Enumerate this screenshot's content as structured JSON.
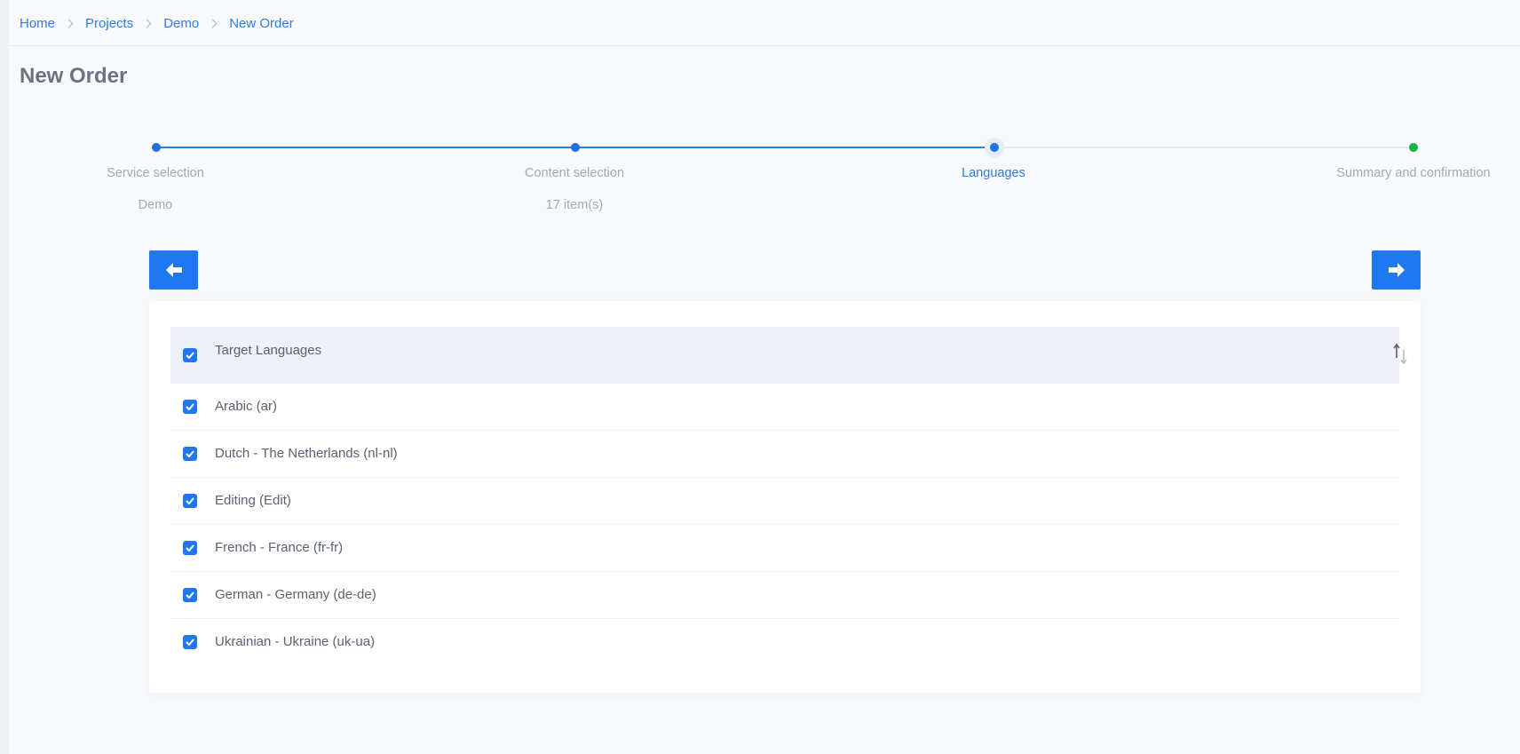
{
  "breadcrumb": [
    "Home",
    "Projects",
    "Demo",
    "New Order"
  ],
  "page": {
    "title": "New Order"
  },
  "stepper": {
    "steps": [
      {
        "label": "Service selection",
        "sub": "Demo",
        "state": "done"
      },
      {
        "label": "Content selection",
        "sub": "17 item(s)",
        "state": "done"
      },
      {
        "label": "Languages",
        "sub": "",
        "state": "current"
      },
      {
        "label": "Summary and confirmation",
        "sub": "",
        "state": "final"
      }
    ]
  },
  "nav": {
    "back_icon": "arrow-left-icon",
    "next_icon": "arrow-right-icon"
  },
  "table": {
    "header": {
      "label": "Target Languages",
      "checked": true,
      "sort_icon": "sort-icon"
    },
    "rows": [
      {
        "label": "Arabic (ar)",
        "checked": true
      },
      {
        "label": "Dutch - The Netherlands (nl-nl)",
        "checked": true
      },
      {
        "label": "Editing (Edit)",
        "checked": true
      },
      {
        "label": "French - France (fr-fr)",
        "checked": true
      },
      {
        "label": "German - Germany (de-de)",
        "checked": true
      },
      {
        "label": "Ukrainian - Ukraine (uk-ua)",
        "checked": true
      }
    ]
  },
  "colors": {
    "accent": "#1f78f0",
    "success": "#12b34a",
    "muted_text": "#a3aab4"
  }
}
